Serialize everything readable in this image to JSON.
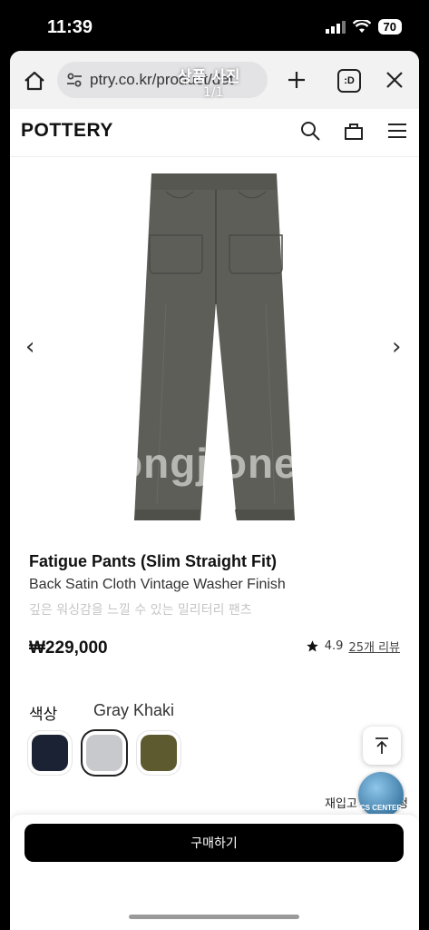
{
  "status_bar": {
    "time": "11:39",
    "battery": "70"
  },
  "browser": {
    "url": "ptry.co.kr/product/det",
    "overlay_title": "상품 사진",
    "overlay_index": "1/1",
    "tabs_label": ":D"
  },
  "site": {
    "logo": "POTTERY"
  },
  "gallery": {
    "prev": "‹",
    "next": "›",
    "watermark": "ongjione"
  },
  "product": {
    "name": "Fatigue Pants (Slim Straight Fit)",
    "subtitle": "Back Satin Cloth Vintage Washer Finish",
    "description": "깊은 워싱감을 느낄 수 있는 밀리터리 팬츠",
    "price": "₩229,000",
    "rating": "4.9",
    "reviews": "25개 리뷰"
  },
  "options": {
    "color_label": "색상",
    "selected_color": "Gray Khaki",
    "swatches": [
      {
        "color": "#1b2233"
      },
      {
        "color": "#c7c9cc"
      },
      {
        "color": "#5c5a2e"
      }
    ]
  },
  "floating": {
    "restock": "재입고 알림 신청",
    "cs_badge": "CS CENTER"
  },
  "cta": {
    "buy_label": "구매하기"
  }
}
